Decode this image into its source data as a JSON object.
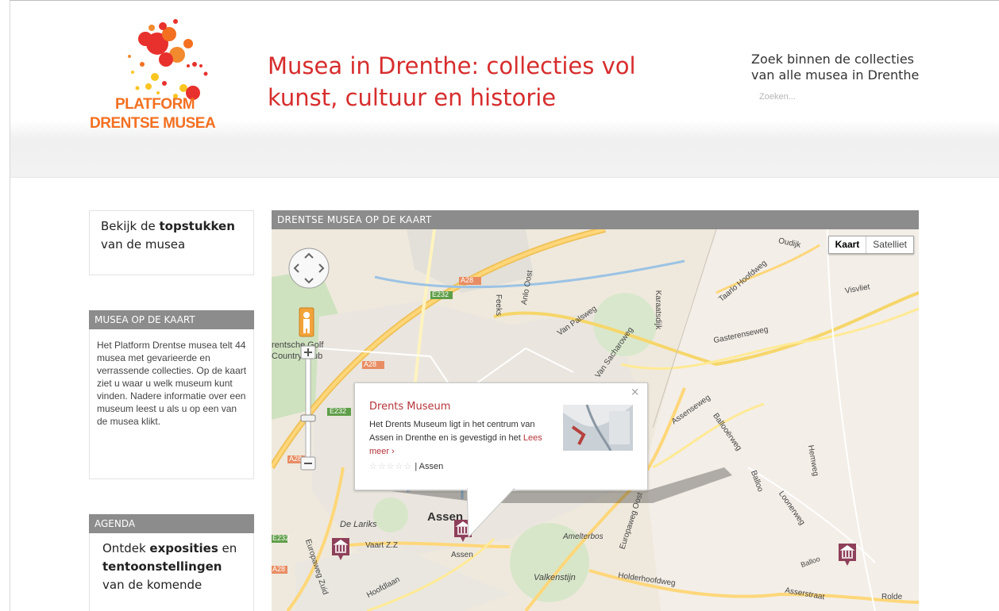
{
  "header": {
    "logo": {
      "line1": "PLATFORM",
      "line2": "DRENTSE MUSEA"
    },
    "tagline": "Musea in Drenthe: collecties vol kunst, cultuur en historie",
    "search": {
      "title": "Zoek binnen de collecties van alle musea in Drenthe",
      "placeholder": "Zoeken..."
    }
  },
  "sidebar": {
    "topstukken": {
      "pre": "Bekijk de ",
      "bold": "topstukken",
      "post": " van de musea"
    },
    "kaart": {
      "header": "Musea op de kaart",
      "text": "Het Platform Drentse musea telt 44 musea met gevarieerde en verrassende collecties. Op de kaart ziet u waar u welk museum kunt vinden. Nadere informatie over een museum leest u als u op een van de musea klikt."
    },
    "agenda": {
      "header": "Agenda",
      "pre": "Ontdek ",
      "bold1": "exposities",
      "mid": " en ",
      "bold2": "tentoonstellingen",
      "post": " van de komende"
    }
  },
  "map": {
    "header": "DRENTSE MUSEA OP DE KAART",
    "type_map": "Kaart",
    "type_satellite": "Satelliet",
    "popup": {
      "close": "×",
      "title": "Drents Museum",
      "text": "Het Drents Museum ligt in het centrum van Assen in Drenthe en is gevestigd in het",
      "more": "Lees meer ›",
      "location": "| Assen",
      "stars": "☆☆☆☆☆"
    },
    "labels": {
      "country_club1": "rentsche Golf",
      "country_club2": "Country Club",
      "oudijk": "Oudijk",
      "visvliet": "Visvliet",
      "gasterenseweg": "Gasterenseweg",
      "assen_city": "Assen",
      "assen_station": "Assen",
      "de_lariks": "De Lariks",
      "vaart": "Vaart Z.Z",
      "amelterbos": "Amelterbos",
      "valkenstijn": "Valkenstijn",
      "holderhoofdweg": "Holderhoofdweg",
      "asserstraat": "Asserstraat",
      "rolde": "Rolde",
      "hoofdlaan": "Hoofdlaan",
      "europaweg_zuid": "Europaweg Zuid",
      "europaweg_oost": "Europaweg Oost",
      "balloo": "Balloo",
      "road_a28_1": "A28",
      "road_a28_2": "A28",
      "road_a28_3": "A28",
      "road_e232_1": "E232",
      "road_e232_2": "E232",
      "road_e232_3": "E232",
      "road_a28_4": "A28",
      "assenseweg": "Assenseweg",
      "ballooerweg": "Ballooërweg",
      "loonerweg": "Loonerweg",
      "karaatsdijk": "Karaatsdijk",
      "feeks": "Feeks",
      "anlo_oost": "Anlo Oost",
      "van_palsweg": "Van Palsweg",
      "van_sacharoweg": "Van Sacharoweg",
      "taarloseweg": "Taarlo Hoofdweg",
      "hemweg": "Hemweg"
    }
  },
  "colors": {
    "accent": "#d72d2d",
    "header_bar": "#8c8c8c",
    "link": "#b5343a",
    "logo_orange": "#f37021"
  }
}
